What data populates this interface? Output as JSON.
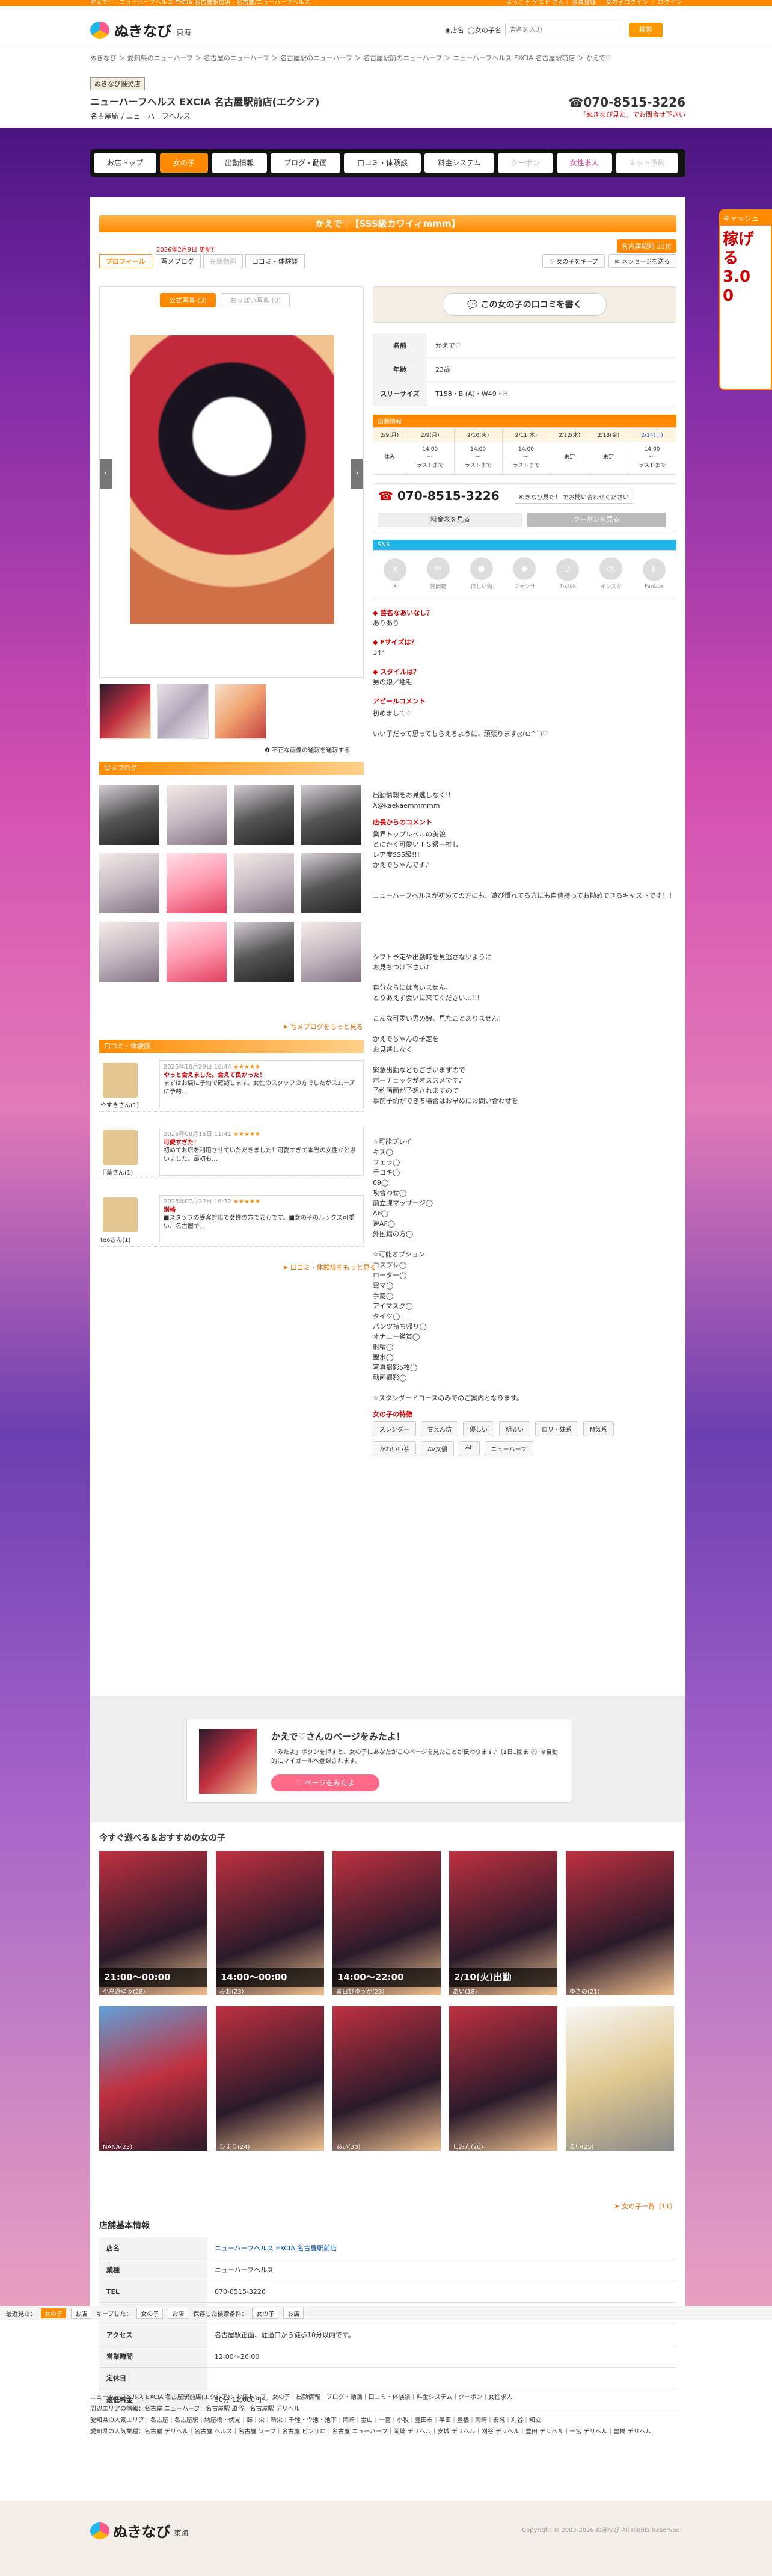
{
  "topbar": {
    "left": "かえで♡ - ニューハーフヘルス EXCIA 名古屋駅前店 - 名古屋/ニューハーフヘルス",
    "right": "ようこそ ゲスト さん｜ 会員登録 ｜ 女の子ログイン ｜ ログイン"
  },
  "header": {
    "logo": "ぬきなび",
    "region": "東海",
    "search_opt1": "◉店名",
    "search_opt2": "◯女の子名",
    "search_placeholder": "店名を入力",
    "search_btn": "検索"
  },
  "breadcrumb": "ぬきなび ＞ 愛知県のニューハーフ ＞ 名古屋のニューハーフ ＞ 名古屋駅のニューハーフ ＞ 名古屋駅前のニューハーフ ＞ ニューハーフヘルス EXCIA 名古屋駅前店 ＞ かえで♡",
  "shop": {
    "badge": "ぬきなび推奨店",
    "name": "ニューハーフヘルス EXCIA 名古屋駅前店(エクシア)",
    "type": "名古屋駅 / ニューハーフヘルス",
    "tel": "☎070-8515-3226",
    "tel_note": "「ぬきなび見た」でお問合せ下さい"
  },
  "gnav": [
    {
      "label": "お店トップ",
      "cls": ""
    },
    {
      "label": "女の子",
      "cls": "on"
    },
    {
      "label": "出勤情報",
      "cls": ""
    },
    {
      "label": "ブログ・動画",
      "cls": ""
    },
    {
      "label": "口コミ・体験談",
      "cls": ""
    },
    {
      "label": "料金システム",
      "cls": ""
    },
    {
      "label": "クーポン",
      "cls": "dim"
    },
    {
      "label": "女性求人",
      "cls": "pink"
    },
    {
      "label": "ネット予約",
      "cls": "dim"
    }
  ],
  "side_ad": {
    "head": "キャッシュ",
    "body": "稼げ\nる\n3.0\n0"
  },
  "girl": {
    "title": "かえで♡【SSS級カワイィmmm】",
    "update": "2026年2月9日 更新!!",
    "rank": "名古屋駅前 21位"
  },
  "tabs": [
    {
      "label": "プロフィール",
      "cls": "on"
    },
    {
      "label": "写メブログ",
      "cls": ""
    },
    {
      "label": "在籍動画",
      "cls": "dim"
    },
    {
      "label": "口コミ・体験談",
      "cls": ""
    }
  ],
  "tabs_r": [
    "♡ 女の子をキープ",
    "✉ メッセージを送る"
  ],
  "gallery": {
    "tab_on": "公式写真 (3)",
    "tab_off": "おっぱい写真 (0)",
    "note": "❶ 不正な画像の通報を通報する"
  },
  "blog": {
    "head": "写メブログ",
    "more": "➤ 写メブログをもっと見る"
  },
  "reviews": {
    "head": "口コミ・体験談",
    "more": "➤ 口コミ・体験談をもっと見る",
    "items": [
      {
        "name": "やすきさん(1)",
        "date": "2025年10月29日 16:44",
        "stars": "★★★★★",
        "head": "やっと会えました。会えて良かった！",
        "body": "まずはお店に予約で確認します。女性のスタッフの方でしたがスムーズに予約…"
      },
      {
        "name": "千葉さん(1)",
        "date": "2025年08月16日 11:41",
        "stars": "★★★★★",
        "head": "可愛すぎた！",
        "body": "初めてお店を利用させていただきました！可愛すぎて本当の女性かと思いました。最初も…"
      },
      {
        "name": "teoさん(1)",
        "date": "2025年07月22日 16:32",
        "stars": "★★★★★",
        "head": "別格",
        "body": "■スタッフの受客対応で女性の方で安心です。■女の子のルックス可愛い、名古屋で…"
      }
    ]
  },
  "review_btn": "💬 この女の子の口コミを書く",
  "profile": [
    {
      "k": "名前",
      "v": "かえで♡"
    },
    {
      "k": "年齢",
      "v": "23歳"
    },
    {
      "k": "スリーサイズ",
      "v": "T158・B (A)・W49・H"
    }
  ],
  "schedule": {
    "head": "出勤情報",
    "days": [
      "2/9(月)",
      "2/9(月)",
      "2/10(火)",
      "2/11(水)",
      "2/12(木)",
      "2/13(金)",
      "2/14(土)"
    ],
    "times": [
      "休み",
      "14:00\n〜\nラストまで",
      "14:00\n〜\nラストまで",
      "14:00\n〜\nラストまで",
      "未定",
      "未定",
      "14:00\n〜\nラストまで"
    ]
  },
  "tel": {
    "number": "070-8515-3226",
    "pill": "ぬきなび見た！ でお問い合わせください",
    "btn1": "料金表を見る",
    "btn2": "クーポンを見る"
  },
  "sns": {
    "head": "SNS",
    "items": [
      {
        "i": "X",
        "l": "X"
      },
      {
        "i": "✉",
        "l": "質問箱"
      },
      {
        "i": "●",
        "l": "ほしい物"
      },
      {
        "i": "◆",
        "l": "ファンサ"
      },
      {
        "i": "♪",
        "l": "TikTok"
      },
      {
        "i": "◎",
        "l": "インスタ"
      },
      {
        "i": "F",
        "l": "Fanbox"
      }
    ]
  },
  "qa": [
    {
      "q": "◆ 芸名なあいなし？",
      "a": "ありあり"
    },
    {
      "q": "◆ Fサイズは？",
      "a": "14°"
    },
    {
      "q": "◆ スタイルは？",
      "a": "男の娘／地毛"
    }
  ],
  "appeal": {
    "title": "アピールコメント",
    "text": "初めまして♡\n\nいい子だって思ってもらえるように、頑張ります◎(ω^`)♡\n\n\n\n\n\n出勤情報をお見逃しなく!!\nX@kaekaemmmmm"
  },
  "staff": {
    "title": "店長からのコメント",
    "text": "業界トップレベルの美貌\nとにかく可愛いＴＳ級一推し\nレア度SSS級!!!\nかえでちゃんです♪\n\n\nニューハーフヘルスが初めての方にも、遊び慣れてる方にも自信持ってお勧めできるキャストです！！\n\n\n\n\n\nシフト予定や出勤時を見逃さないように\nお見ちつけ下さい♪\n\n自分ならには言いません。\nとりあえず会いに来てください…!!!\n\nこんな可愛い男の娘、見たことありません！\n\nかえでちゃんの予定を\nお見逃しなく\n\n緊急出勤などもございますので\nボーチェックがオススメです♪\n予約画面が予想されますので\n事前予約ができる場合はお早めにお問い合わせを\n\n\n\n☆可能プレイ\nキス◯\nフェラ◯\n手コキ◯\n69◯\n攻合わせ◯\n前立腺マッサージ◯\nAF◯\n逆AF◯\n外国籍の方◯\n\n☆可能オプション\nコスプレ◯\nローター◯\n電マ◯\n手錠◯\nアイマスク◯\nタイツ◯\nパンツ持ち帰り◯\nオナニー鑑賞◯\n射精◯\n聖水◯\n写真撮影5枚◯\n動画撮影◯\n\n☆スタンダードコースのみでのご案内となります。"
  },
  "features": {
    "title": "女の子の特徴",
    "tags": [
      "スレンダー",
      "甘えん坊",
      "優しい",
      "明るい",
      "ロリ・妹系",
      "M気系",
      "かわいい系",
      "AV女優",
      "AF",
      "ニューハーフ"
    ]
  },
  "cta": {
    "title": "かえで♡さんのページをみたよ！",
    "desc": "「みたよ」ボタンを押すと、女の子にあなたがこのページを見たことが伝わります♪（1日1回まで）※自動的にマイガールへ登録されます。",
    "btn": "♡ ページをみたよ"
  },
  "recommend": {
    "head": "今すぐ遊べる＆おすすめの女の子",
    "more": "➤ 女の子一覧（11）",
    "cards": [
      {
        "time": "21:00〜00:00",
        "name": "小鳥遊ゆう(28)",
        "cls": ""
      },
      {
        "time": "14:00〜00:00",
        "name": "みお(23)",
        "cls": ""
      },
      {
        "time": "14:00〜22:00",
        "name": "春日野ゆうか(23)",
        "cls": ""
      },
      {
        "time": "2/10(火)出勤",
        "name": "あい(18)",
        "cls": ""
      },
      {
        "time": "",
        "name": "ゆきの(21)",
        "cls": ""
      },
      {
        "time": "",
        "name": "NANA(23)",
        "cls": "k"
      },
      {
        "time": "",
        "name": "ひまり(24)",
        "cls": ""
      },
      {
        "time": "",
        "name": "あい(30)",
        "cls": ""
      },
      {
        "time": "",
        "name": "しおん(20)",
        "cls": ""
      },
      {
        "time": "",
        "name": "るい(25)",
        "cls": "b"
      }
    ]
  },
  "info": {
    "head": "店舗基本情報",
    "rows": [
      {
        "k": "店名",
        "v": "ニューハーフヘルス EXCIA 名古屋駅前店",
        "link": true
      },
      {
        "k": "業種",
        "v": "ニューハーフヘルス",
        "link": false
      },
      {
        "k": "TEL",
        "v": "070-8515-3226",
        "link": false
      },
      {
        "k": "住所",
        "v": "愛知県名古屋市西区名駅2丁目26 ➤地図を見る",
        "link": false
      },
      {
        "k": "アクセス",
        "v": "名古屋駅正面、駐過口から徒歩10分以内です。",
        "link": false
      },
      {
        "k": "営業時間",
        "v": "12:00〜26:00",
        "link": false
      },
      {
        "k": "定休日",
        "v": "",
        "link": false
      },
      {
        "k": "最低料金",
        "v": "50分 12,000円〜",
        "link": false
      }
    ]
  },
  "bottombar": {
    "label1": "最近見た：",
    "b1": "女の子",
    "b2": "お店",
    "label2": "キープした：",
    "b3": "女の子",
    "b4": "お店",
    "label3": "保存した検索条件：",
    "b5": "女の子",
    "b6": "お店"
  },
  "footer_links": [
    "ニューハーフヘルス EXCIA 名古屋駅前店(エクシア)：お店トップ｜女の子｜出勤情報｜ブログ・動画｜口コミ・体験談｜料金システム｜クーポン｜女性求人",
    "周辺エリアの情報：名古屋 ニューハーフ｜名古屋駅 風俗｜名古屋駅 デリヘル",
    "愛知県の人気エリア：名古屋｜名古屋駅｜納屋橋・伏見｜錦｜栄｜新栄｜千種・今池・池下｜岡崎｜金山｜一宮｜小牧｜豊田市｜半田｜豊橋｜岡崎｜安城｜刈谷｜知立",
    "愛知県の人気業種：名古屋 デリヘル｜名古屋 ヘルス｜名古屋 ソープ｜名古屋 ピンサロ｜名古屋 ニューハーフ｜岡崎 デリヘル｜安城 デリヘル｜刈谷 デリヘル｜豊田 デリヘル｜一宮 デリヘル｜豊橋 デリヘル"
  ],
  "copyright": "Copyright © 2003-2026 ぬきなび All Rights Reserved."
}
